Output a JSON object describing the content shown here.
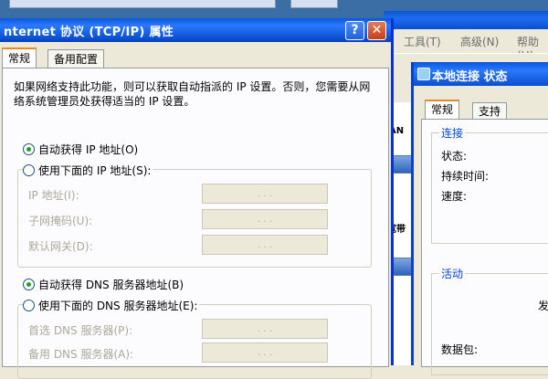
{
  "tcp_dialog": {
    "title": "nternet 协议 (TCP/IP) 属性",
    "help_btn": "?",
    "close_btn": "✕",
    "tabs": [
      {
        "label": "常规",
        "active": true
      },
      {
        "label": "备用配置",
        "active": false
      }
    ],
    "description": "如果网络支持此功能，则可以获取自动指派的 IP 设置。否则，您需要从网络系统管理员处获得适当的 IP 设置。",
    "ip_auto_label": "自动获得 IP 地址(O)",
    "ip_auto_selected": true,
    "ip_manual_label": "使用下面的 IP 地址(S):",
    "ip_manual_selected": false,
    "ip_fields": [
      {
        "label": "IP 地址(I):",
        "value": ". . ."
      },
      {
        "label": "子网掩码(U):",
        "value": ". . ."
      },
      {
        "label": "默认网关(D):",
        "value": ". . ."
      }
    ],
    "dns_auto_label": "自动获得 DNS 服务器地址(B)",
    "dns_auto_selected": true,
    "dns_manual_label": "使用下面的 DNS 服务器地址(E):",
    "dns_manual_selected": false,
    "dns_fields": [
      {
        "label": "首选 DNS 服务器(P):",
        "value": ". . ."
      },
      {
        "label": "备用 DNS 服务器(A):",
        "value": ". . ."
      }
    ]
  },
  "explorer": {
    "menu": [
      "工具(T)",
      "高级(N)",
      "帮助(H)"
    ],
    "labels": [
      "AN",
      "宽带"
    ]
  },
  "status_dialog": {
    "title": "本地连接 状态",
    "tabs": [
      {
        "label": "常规",
        "active": true
      },
      {
        "label": "支持",
        "active": false
      }
    ],
    "connection_group": "连接",
    "fields": [
      "状态:",
      "持续时间:",
      "速度:"
    ],
    "activity_group": "活动",
    "sent_partial": "发",
    "packets_label": "数据包:"
  },
  "colors": {
    "titlebar": "#0a57d9",
    "radio_on": "#21a121",
    "group_title": "#0046d5"
  }
}
